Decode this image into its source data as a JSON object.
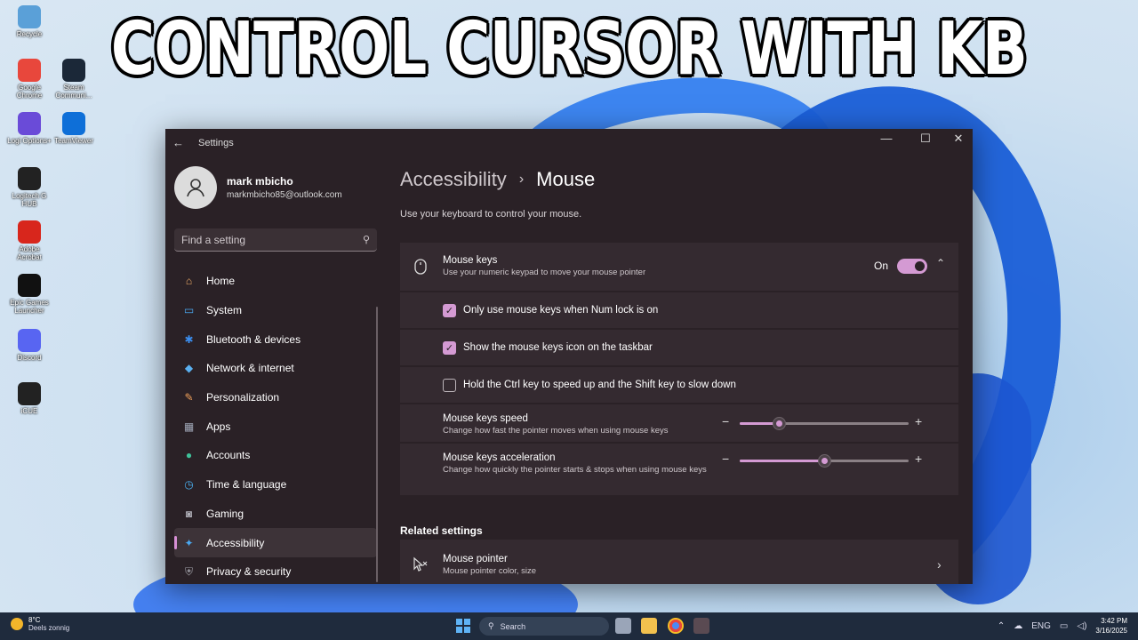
{
  "headline": "CONTROL CURSOR WITH KB",
  "desktop_icons": [
    {
      "label": "Recycle",
      "color": "#5aa0d8"
    },
    {
      "label": "Google Chrome",
      "color": "#e8473c"
    },
    {
      "label": "Steam Communi...",
      "color": "#1b2838"
    },
    {
      "label": "Logi Options+",
      "color": "#6a4bd8"
    },
    {
      "label": "TeamViewer",
      "color": "#0e6fd8"
    },
    {
      "label": "Logitech G HUB",
      "color": "#222222"
    },
    {
      "label": "Adobe Acrobat",
      "color": "#d8261c"
    },
    {
      "label": "Epic Games Launcher",
      "color": "#111111"
    },
    {
      "label": "Discord",
      "color": "#5865f2"
    },
    {
      "label": "iCUE",
      "color": "#222222"
    }
  ],
  "window": {
    "app_title": "Settings",
    "back_icon": "back-arrow-icon",
    "controls": {
      "minimize": "—",
      "maximize": "☐",
      "close": "✕"
    }
  },
  "profile": {
    "name": "mark mbicho",
    "email": "markmbicho85@outlook.com"
  },
  "search": {
    "placeholder": "Find a setting"
  },
  "nav": [
    {
      "label": "Home",
      "icon": "home-icon",
      "glyph": "⌂",
      "color": "#f3b06a"
    },
    {
      "label": "System",
      "icon": "system-icon",
      "glyph": "▭",
      "color": "#4aa8f0"
    },
    {
      "label": "Bluetooth & devices",
      "icon": "bluetooth-icon",
      "glyph": "✱",
      "color": "#3b8eef"
    },
    {
      "label": "Network & internet",
      "icon": "network-icon",
      "glyph": "◆",
      "color": "#5ab0f0"
    },
    {
      "label": "Personalization",
      "icon": "personalization-icon",
      "glyph": "✎",
      "color": "#f0a05a"
    },
    {
      "label": "Apps",
      "icon": "apps-icon",
      "glyph": "▦",
      "color": "#a0a8b8"
    },
    {
      "label": "Accounts",
      "icon": "accounts-icon",
      "glyph": "●",
      "color": "#3fc29a"
    },
    {
      "label": "Time & language",
      "icon": "time-language-icon",
      "glyph": "◷",
      "color": "#4ab0f0"
    },
    {
      "label": "Gaming",
      "icon": "gaming-icon",
      "glyph": "◙",
      "color": "#b0b0b8"
    },
    {
      "label": "Accessibility",
      "icon": "accessibility-icon",
      "glyph": "✦",
      "color": "#4aa8f0",
      "active": true
    },
    {
      "label": "Privacy & security",
      "icon": "privacy-icon",
      "glyph": "⛨",
      "color": "#a0a0a8"
    }
  ],
  "breadcrumb": {
    "parent": "Accessibility",
    "separator": "›",
    "current": "Mouse"
  },
  "description": "Use your keyboard to control your mouse.",
  "mouse_keys": {
    "title": "Mouse keys",
    "subtitle": "Use your numeric keypad to move your mouse pointer",
    "state_label": "On",
    "enabled": true,
    "icon": "mouse-icon"
  },
  "options": [
    {
      "label": "Only use mouse keys when Num lock is on",
      "checked": true
    },
    {
      "label": "Show the mouse keys icon on the taskbar",
      "checked": true
    },
    {
      "label": "Hold the Ctrl key to speed up and the Shift key to slow down",
      "checked": false
    }
  ],
  "sliders": [
    {
      "title": "Mouse keys speed",
      "subtitle": "Change how fast the pointer moves when using mouse keys",
      "value": 0.23
    },
    {
      "title": "Mouse keys acceleration",
      "subtitle": "Change how quickly the pointer starts & stops when using mouse keys",
      "value": 0.5
    }
  ],
  "related": {
    "heading": "Related settings",
    "items": [
      {
        "title": "Mouse pointer",
        "subtitle": "Mouse pointer color, size",
        "icon": "mouse-pointer-icon"
      }
    ]
  },
  "taskbar": {
    "weather_temp": "8°C",
    "weather_desc": "Deels zonnig",
    "search_label": "Search",
    "language": "ENG",
    "time": "3:42 PM",
    "date": "3/16/2025"
  },
  "colors": {
    "accent": "#d49ad3",
    "window_bg": "#2a2126",
    "card_bg": "#342a30"
  }
}
